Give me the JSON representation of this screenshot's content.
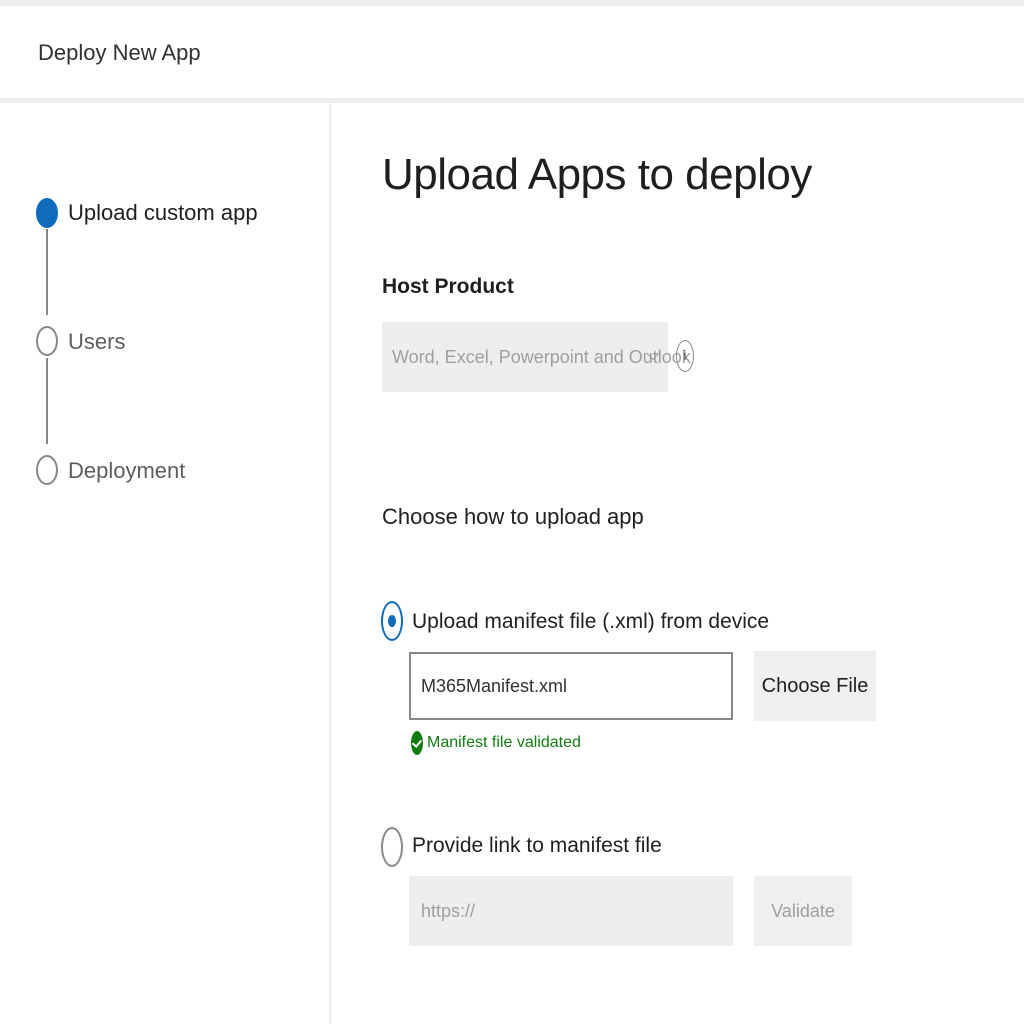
{
  "header": {
    "title": "Deploy New App"
  },
  "steps": [
    {
      "label": "Upload custom app",
      "state": "active"
    },
    {
      "label": "Users",
      "state": "inactive"
    },
    {
      "label": "Deployment",
      "state": "inactive"
    }
  ],
  "main": {
    "title": "Upload Apps to deploy",
    "host_product": {
      "label": "Host Product",
      "value": "Word, Excel, Powerpoint and Outlook",
      "info_icon": "info-icon"
    },
    "upload_section": {
      "label": "Choose how to upload app",
      "option_device": {
        "label": "Upload manifest file (.xml) from device",
        "selected": true,
        "file_value": "M365Manifest.xml",
        "choose_button": "Choose File",
        "validation_message": "Manifest file validated"
      },
      "option_link": {
        "label": "Provide link to manifest file",
        "selected": false,
        "placeholder": "https://",
        "validate_button": "Validate"
      }
    }
  },
  "colors": {
    "accent": "#0f6cbd",
    "success": "#107c10"
  }
}
